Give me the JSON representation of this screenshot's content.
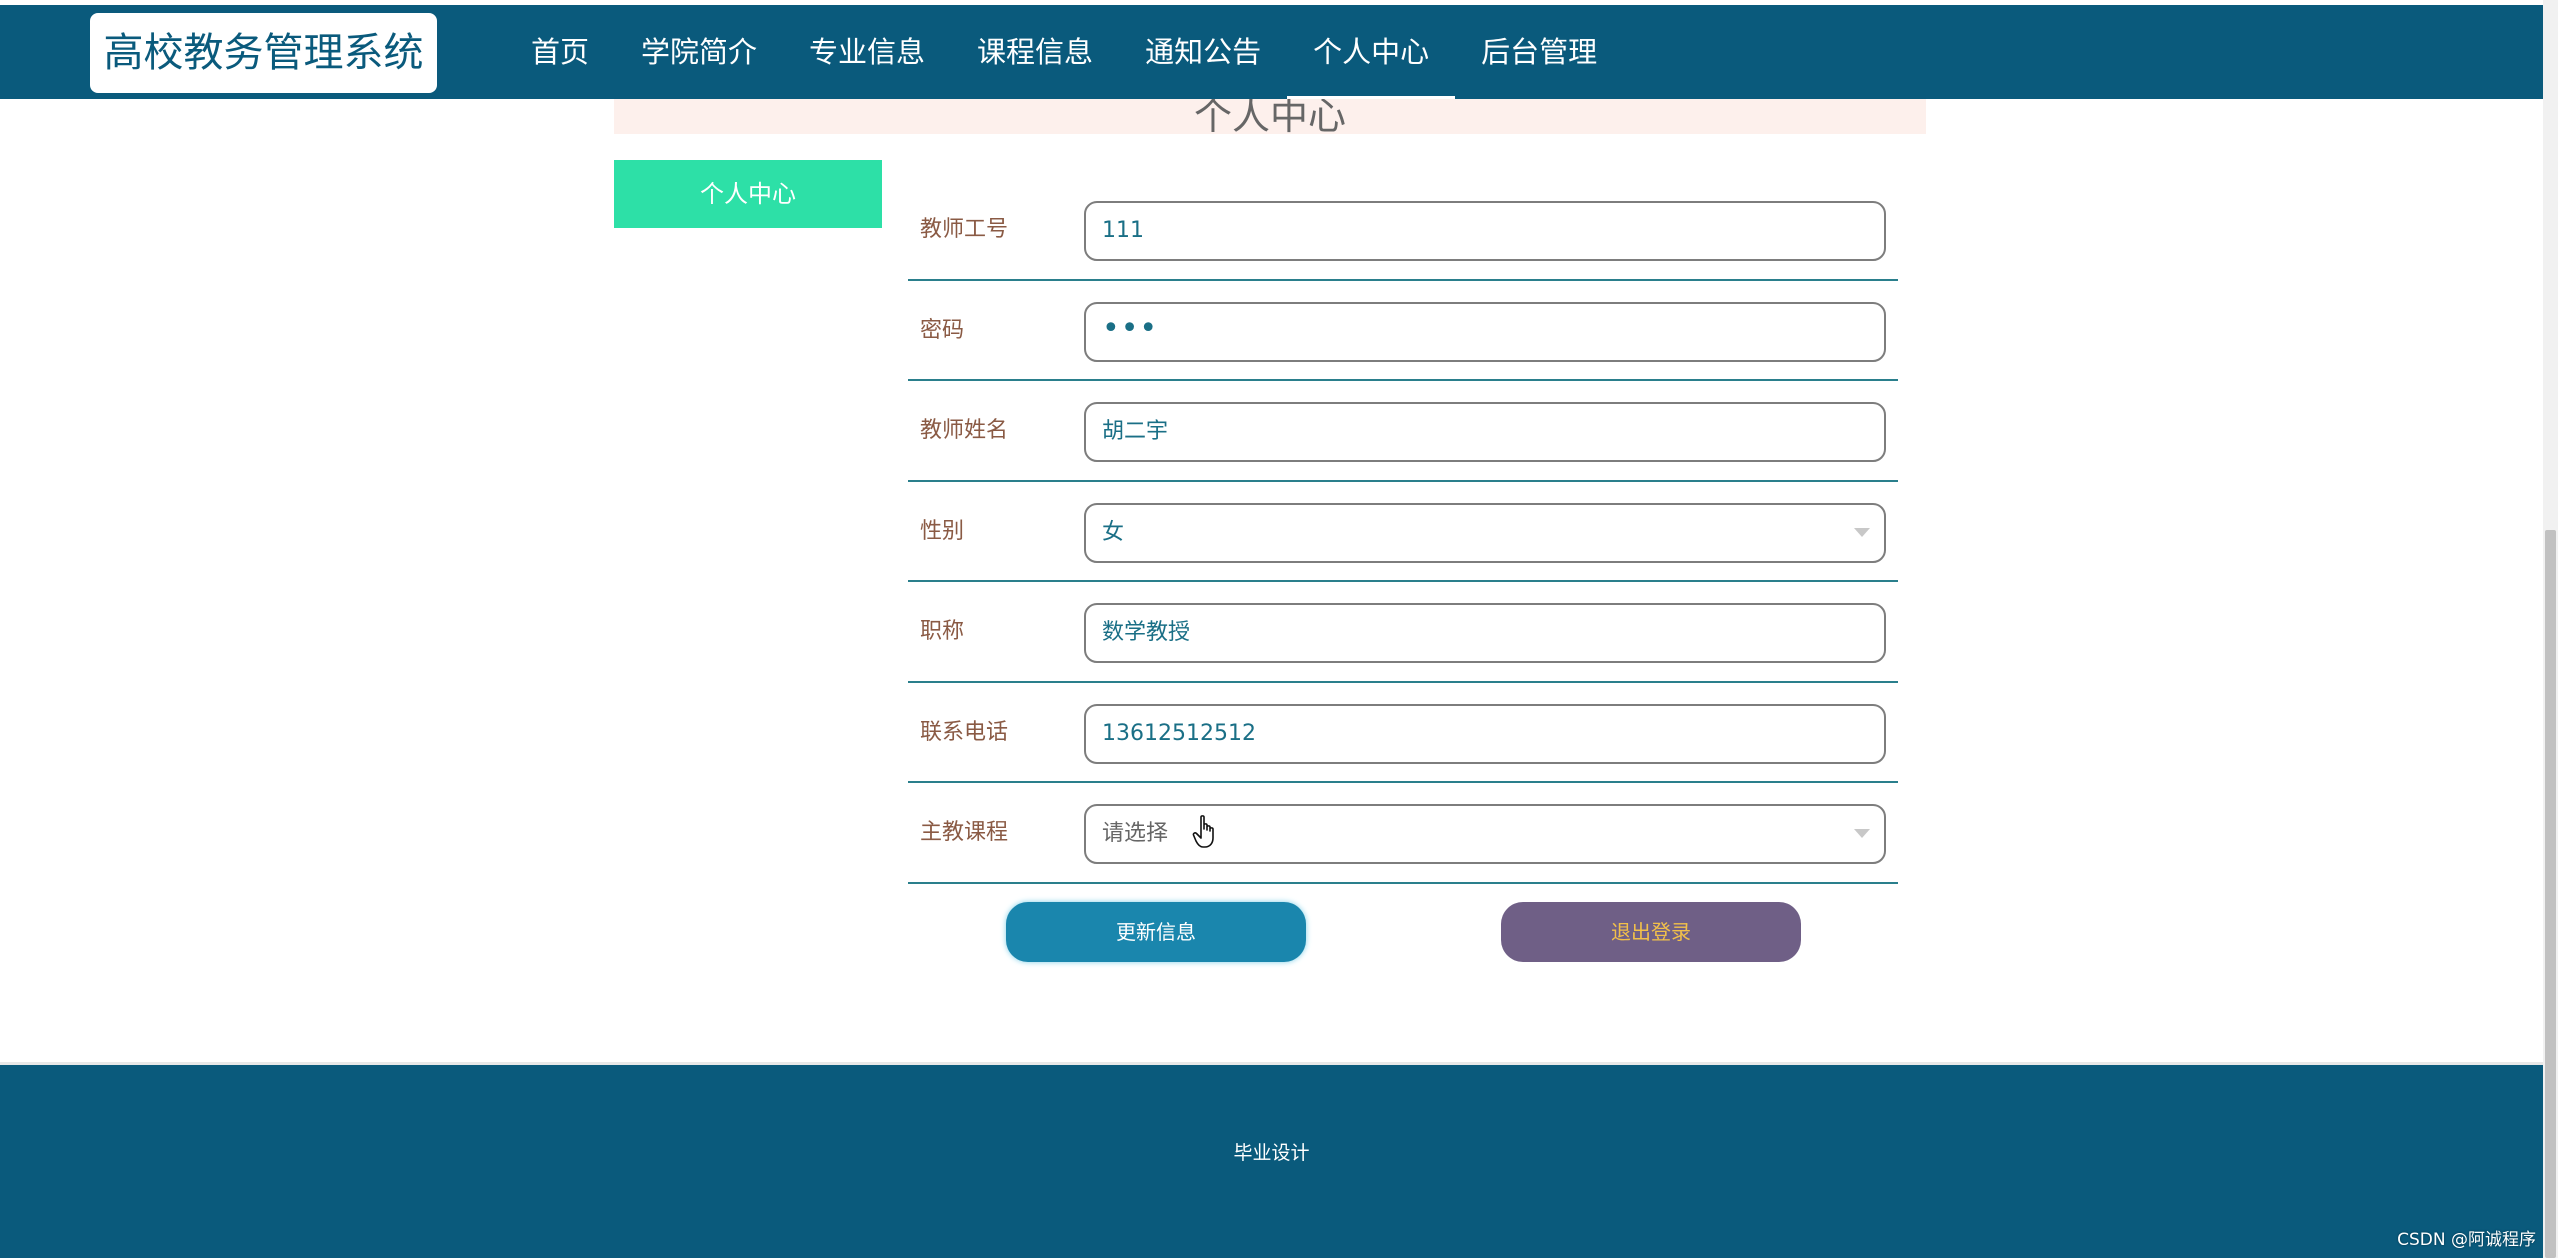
{
  "header": {
    "logo": "高校教务管理系统",
    "nav": [
      {
        "label": "首页",
        "active": false
      },
      {
        "label": "学院简介",
        "active": false
      },
      {
        "label": "专业信息",
        "active": false
      },
      {
        "label": "课程信息",
        "active": false
      },
      {
        "label": "通知公告",
        "active": false
      },
      {
        "label": "个人中心",
        "active": true
      },
      {
        "label": "后台管理",
        "active": false
      }
    ]
  },
  "page": {
    "banner_title": "个人中心",
    "side_menu_item": "个人中心"
  },
  "form": {
    "fields": [
      {
        "label": "教师工号",
        "value": "111",
        "kind": "text"
      },
      {
        "label": "密码",
        "value": "•••",
        "kind": "password"
      },
      {
        "label": "教师姓名",
        "value": "胡二宇",
        "kind": "text"
      },
      {
        "label": "性别",
        "value": "女",
        "kind": "select"
      },
      {
        "label": "职称",
        "value": "数学教授",
        "kind": "text"
      },
      {
        "label": "联系电话",
        "value": "13612512512",
        "kind": "text"
      },
      {
        "label": "主教课程",
        "value": "请选择",
        "kind": "select"
      }
    ],
    "update_button": "更新信息",
    "logout_button": "退出登录"
  },
  "footer": {
    "text": "毕业设计"
  },
  "watermark": "CSDN @阿诚程序",
  "colors": {
    "header_bg": "#0a5a7c",
    "side_menu_bg": "#2de0a7",
    "update_button_bg": "#1a86ad",
    "logout_button_bg": "#6f5f86"
  }
}
